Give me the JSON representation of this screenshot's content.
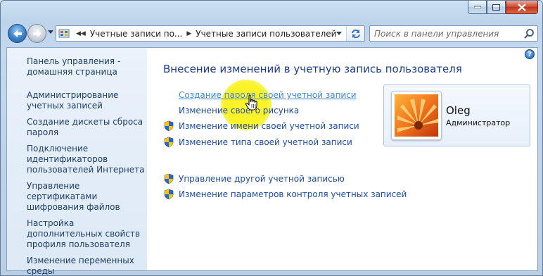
{
  "window": {
    "minimize_icon": "minimize-icon",
    "maximize_icon": "maximize-icon",
    "close_icon": "close-icon"
  },
  "address_bar": {
    "crumbs": [
      "Учетные записи по...",
      "Учетные записи пользователей"
    ]
  },
  "search": {
    "placeholder": "Поиск в панели управления"
  },
  "sidebar": {
    "home": "Панель управления - домашняя страница",
    "items": [
      "Администрирование учетных записей",
      "Создание дискеты сброса пароля",
      "Подключение идентификаторов пользователей Интернета",
      "Управление сертификатами шифрования файлов",
      "Настройка дополнительных свойств профиля пользователя",
      "Изменение переменных среды"
    ]
  },
  "main": {
    "heading": "Внесение изменений в учетную запись пользователя",
    "tasks": [
      "Создание пароля своей учетной записи",
      "Изменение своего рисунка",
      "Изменение имени своей учетной записи",
      "Изменение типа своей учетной записи"
    ],
    "other_tasks": [
      "Управление другой учетной записью",
      "Изменение параметров контроля учетных записей"
    ]
  },
  "user": {
    "name": "Oleg",
    "role": "Администратор"
  },
  "colors": {
    "link": "#1d4ca8",
    "heading": "#1d3c8c",
    "highlight": "#f9ef14"
  }
}
